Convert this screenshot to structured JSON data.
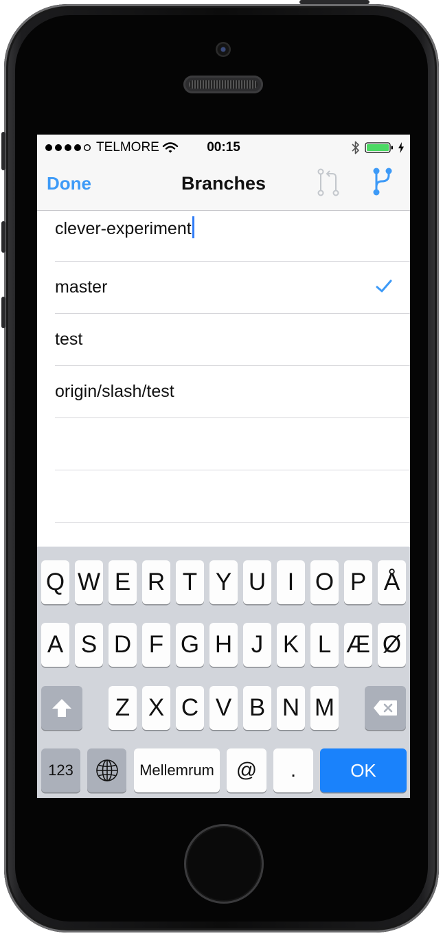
{
  "status": {
    "carrier": "TELMORE",
    "time": "00:15"
  },
  "nav": {
    "done_label": "Done",
    "title": "Branches"
  },
  "new_branch_input": {
    "value": "clever-experiment"
  },
  "branches": [
    {
      "name": "master",
      "selected": true
    },
    {
      "name": "test",
      "selected": false
    },
    {
      "name": "origin/slash/test",
      "selected": false
    }
  ],
  "keyboard": {
    "row1": [
      "Q",
      "W",
      "E",
      "R",
      "T",
      "Y",
      "U",
      "I",
      "O",
      "P",
      "Å"
    ],
    "row2": [
      "A",
      "S",
      "D",
      "F",
      "G",
      "H",
      "J",
      "K",
      "L",
      "Æ",
      "Ø"
    ],
    "row3": [
      "Z",
      "X",
      "C",
      "V",
      "B",
      "N",
      "M"
    ],
    "numbers_label": "123",
    "space_label": "Mellemrum",
    "at_label": "@",
    "period_label": ".",
    "return_label": "OK"
  },
  "colors": {
    "accent": "#3d9af7",
    "ok_key": "#1a82fb",
    "battery": "#4cd964"
  }
}
